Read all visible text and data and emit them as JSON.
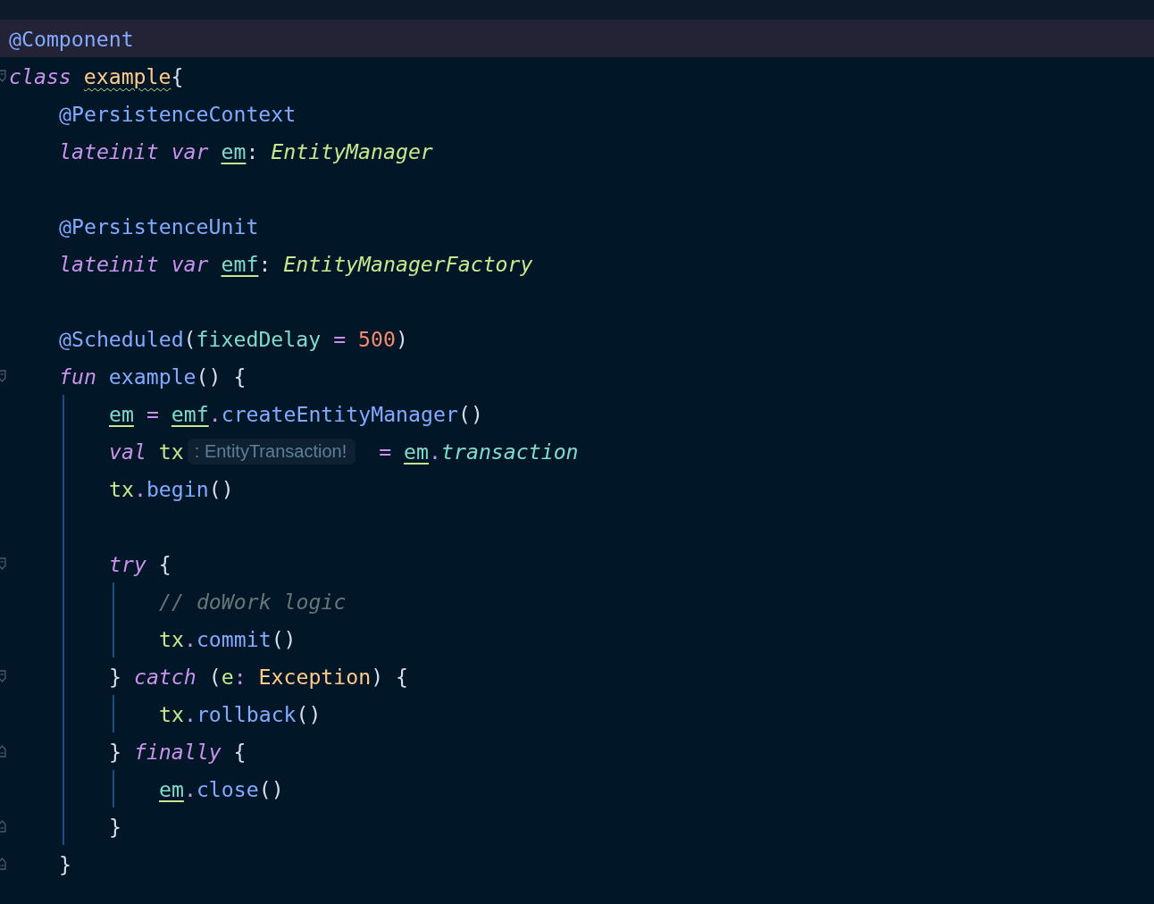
{
  "editor": {
    "lines": [
      {
        "current": true,
        "tokens": [
          {
            "text": "@Component",
            "kind": "annot"
          }
        ]
      },
      {
        "fold_start": true,
        "guide": false,
        "tokens": [
          {
            "text": "class ",
            "kind": "kw"
          },
          {
            "text": "example",
            "kind": "warnclass"
          },
          {
            "text": "{",
            "kind": "plain"
          }
        ],
        "children": [
          {
            "tokens": [
              {
                "text": "@PersistenceContext",
                "kind": "annot"
              }
            ]
          },
          {
            "blank_after": true,
            "tokens": [
              {
                "text": "lateinit var ",
                "kind": "kw"
              },
              {
                "text": "em",
                "kind": "prop"
              },
              {
                "text": ": ",
                "kind": "plain"
              },
              {
                "text": "EntityManager",
                "kind": "type"
              }
            ]
          },
          {
            "tokens": [
              {
                "text": "@PersistenceUnit",
                "kind": "annot"
              }
            ]
          },
          {
            "blank_after": true,
            "tokens": [
              {
                "text": "lateinit var ",
                "kind": "kw"
              },
              {
                "text": "emf",
                "kind": "prop"
              },
              {
                "text": ": ",
                "kind": "plain"
              },
              {
                "text": "EntityManagerFactory",
                "kind": "type"
              }
            ]
          },
          {
            "tokens": [
              {
                "text": "@Scheduled",
                "kind": "annot"
              },
              {
                "text": "(",
                "kind": "plain"
              },
              {
                "text": "fixedDelay",
                "kind": "arg"
              },
              {
                "text": " = ",
                "kind": "op"
              },
              {
                "text": "500",
                "kind": "num"
              },
              {
                "text": ")",
                "kind": "plain"
              }
            ]
          },
          {
            "fold_start": true,
            "guide": true,
            "tokens": [
              {
                "text": "fun ",
                "kind": "kw"
              },
              {
                "text": "example",
                "kind": "fn"
              },
              {
                "text": "() {",
                "kind": "plain"
              }
            ],
            "children": [
              {
                "tokens": [
                  {
                    "text": "em",
                    "kind": "prop"
                  },
                  {
                    "text": " = ",
                    "kind": "op"
                  },
                  {
                    "text": "emf",
                    "kind": "prop"
                  },
                  {
                    "text": ".",
                    "kind": "op"
                  },
                  {
                    "text": "createEntityManager",
                    "kind": "fn"
                  },
                  {
                    "text": "()",
                    "kind": "plain"
                  }
                ]
              },
              {
                "tokens": [
                  {
                    "text": "val ",
                    "kind": "kw"
                  },
                  {
                    "text": "tx",
                    "kind": "local"
                  },
                  {
                    "text": ": EntityTransaction!",
                    "kind": "hint"
                  },
                  {
                    "text": " = ",
                    "kind": "op"
                  },
                  {
                    "text": "em",
                    "kind": "prop"
                  },
                  {
                    "text": ".",
                    "kind": "op"
                  },
                  {
                    "text": "transaction",
                    "kind": "field"
                  }
                ]
              },
              {
                "blank_after": true,
                "tokens": [
                  {
                    "text": "tx",
                    "kind": "local"
                  },
                  {
                    "text": ".",
                    "kind": "op"
                  },
                  {
                    "text": "begin",
                    "kind": "fn"
                  },
                  {
                    "text": "()",
                    "kind": "plain"
                  }
                ]
              },
              {
                "fold_start": true,
                "guide": true,
                "tokens": [
                  {
                    "text": "try",
                    "kind": "kw"
                  },
                  {
                    "text": " {",
                    "kind": "plain"
                  }
                ],
                "children": [
                  {
                    "tokens": [
                      {
                        "text": "// doWork logic",
                        "kind": "comment"
                      }
                    ]
                  },
                  {
                    "tokens": [
                      {
                        "text": "tx",
                        "kind": "local"
                      },
                      {
                        "text": ".",
                        "kind": "op"
                      },
                      {
                        "text": "commit",
                        "kind": "fn"
                      },
                      {
                        "text": "()",
                        "kind": "plain"
                      }
                    ]
                  }
                ]
              },
              {
                "fold_start": true,
                "guide": true,
                "tokens": [
                  {
                    "text": "} ",
                    "kind": "plain"
                  },
                  {
                    "text": "catch",
                    "kind": "kw"
                  },
                  {
                    "text": " (",
                    "kind": "plain"
                  },
                  {
                    "text": "e",
                    "kind": "local"
                  },
                  {
                    "text": ": ",
                    "kind": "op"
                  },
                  {
                    "text": "Exception",
                    "kind": "cls"
                  },
                  {
                    "text": ") {",
                    "kind": "plain"
                  }
                ],
                "children": [
                  {
                    "tokens": [
                      {
                        "text": "tx",
                        "kind": "local"
                      },
                      {
                        "text": ".",
                        "kind": "op"
                      },
                      {
                        "text": "rollback",
                        "kind": "fn"
                      },
                      {
                        "text": "()",
                        "kind": "plain"
                      }
                    ]
                  }
                ]
              },
              {
                "fold_end": true,
                "guide": true,
                "tokens": [
                  {
                    "text": "} ",
                    "kind": "plain"
                  },
                  {
                    "text": "finally",
                    "kind": "kw"
                  },
                  {
                    "text": " {",
                    "kind": "plain"
                  }
                ],
                "children": [
                  {
                    "tokens": [
                      {
                        "text": "em",
                        "kind": "prop"
                      },
                      {
                        "text": ".",
                        "kind": "op"
                      },
                      {
                        "text": "close",
                        "kind": "fn"
                      },
                      {
                        "text": "()",
                        "kind": "plain"
                      }
                    ]
                  }
                ]
              },
              {
                "fold_end": true,
                "tokens": [
                  {
                    "text": "}",
                    "kind": "plain"
                  }
                ]
              }
            ]
          },
          {
            "fold_end": true,
            "tokens": [
              {
                "text": "}",
                "kind": "plain"
              }
            ]
          }
        ]
      }
    ]
  }
}
